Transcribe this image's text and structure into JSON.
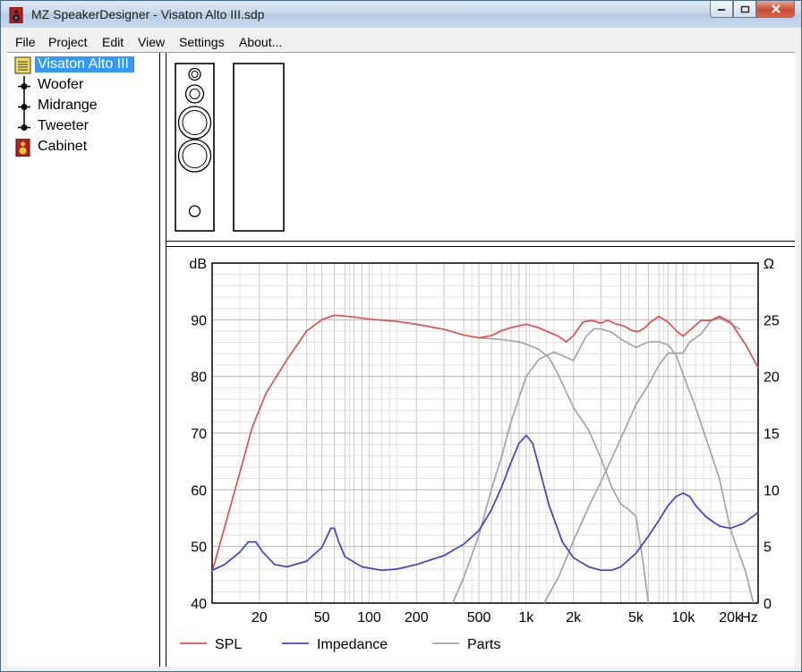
{
  "window": {
    "title": "MZ SpeakerDesigner - Visaton Alto III.sdp"
  },
  "menu": [
    "File",
    "Project",
    "Edit",
    "View",
    "Settings",
    "About..."
  ],
  "tree": {
    "project": "Visaton Alto III",
    "items": [
      "Woofer",
      "Midrange",
      "Tweeter",
      "Cabinet"
    ]
  },
  "colors": {
    "spl": "#e05050",
    "impedance": "#4040cc",
    "parts": "#a0a0a0",
    "selection": "#3399ff"
  },
  "chart_data": {
    "type": "line",
    "x_scale": "log",
    "xlim": [
      10,
      30000
    ],
    "x_ticks": [
      {
        "v": 20,
        "label": "20"
      },
      {
        "v": 50,
        "label": "50"
      },
      {
        "v": 100,
        "label": "100"
      },
      {
        "v": 200,
        "label": "200"
      },
      {
        "v": 500,
        "label": "500"
      },
      {
        "v": 1000,
        "label": "1k"
      },
      {
        "v": 2000,
        "label": "2k"
      },
      {
        "v": 5000,
        "label": "5k"
      },
      {
        "v": 10000,
        "label": "10k"
      },
      {
        "v": 20000,
        "label": "20k"
      }
    ],
    "x_unit": "Hz",
    "ylabel_left": "dB",
    "ylim_left": [
      40,
      100
    ],
    "y_ticks_left": [
      40,
      50,
      60,
      70,
      80,
      90
    ],
    "ylabel_right": "Ω",
    "ylim_right": [
      0,
      30
    ],
    "y_ticks_right": [
      0,
      5,
      10,
      15,
      20,
      25
    ],
    "grid": true,
    "legend_position": "bottom",
    "series": [
      {
        "name": "SPL",
        "axis": "left",
        "color": "#e05050",
        "points": [
          [
            10,
            45.5
          ],
          [
            15,
            63
          ],
          [
            18,
            71
          ],
          [
            22,
            77
          ],
          [
            30,
            83
          ],
          [
            40,
            88
          ],
          [
            50,
            90
          ],
          [
            60,
            90.8
          ],
          [
            80,
            90.5
          ],
          [
            100,
            90.1
          ],
          [
            150,
            89.7
          ],
          [
            200,
            89.2
          ],
          [
            300,
            88.3
          ],
          [
            400,
            87.3
          ],
          [
            500,
            86.8
          ],
          [
            600,
            87.2
          ],
          [
            700,
            88.1
          ],
          [
            800,
            88.6
          ],
          [
            1000,
            89.2
          ],
          [
            1200,
            88.6
          ],
          [
            1400,
            87.8
          ],
          [
            1600,
            87.1
          ],
          [
            1800,
            86.1
          ],
          [
            2000,
            87.2
          ],
          [
            2300,
            89.6
          ],
          [
            2600,
            89.9
          ],
          [
            3000,
            89.4
          ],
          [
            3300,
            89.9
          ],
          [
            3700,
            89.3
          ],
          [
            4200,
            88.9
          ],
          [
            4700,
            88.1
          ],
          [
            5200,
            87.9
          ],
          [
            5700,
            88.6
          ],
          [
            6200,
            89.6
          ],
          [
            7000,
            90.6
          ],
          [
            8000,
            89.6
          ],
          [
            9000,
            88.1
          ],
          [
            10000,
            87.1
          ],
          [
            11500,
            88.6
          ],
          [
            13000,
            89.9
          ],
          [
            15000,
            89.9
          ],
          [
            17000,
            90.6
          ],
          [
            20000,
            89.6
          ],
          [
            25000,
            85.6
          ],
          [
            30000,
            81.5
          ]
        ]
      },
      {
        "name": "Impedance",
        "axis": "right",
        "color": "#4040cc",
        "points": [
          [
            10,
            2.9
          ],
          [
            12,
            3.4
          ],
          [
            15,
            4.5
          ],
          [
            17,
            5.4
          ],
          [
            19,
            5.4
          ],
          [
            21,
            4.5
          ],
          [
            25,
            3.4
          ],
          [
            30,
            3.2
          ],
          [
            40,
            3.7
          ],
          [
            50,
            4.9
          ],
          [
            57,
            6.6
          ],
          [
            60,
            6.6
          ],
          [
            64,
            5.4
          ],
          [
            70,
            4.1
          ],
          [
            90,
            3.2
          ],
          [
            120,
            2.9
          ],
          [
            150,
            3.0
          ],
          [
            200,
            3.4
          ],
          [
            300,
            4.2
          ],
          [
            400,
            5.2
          ],
          [
            500,
            6.4
          ],
          [
            600,
            8.2
          ],
          [
            700,
            10.3
          ],
          [
            800,
            12.4
          ],
          [
            900,
            14.1
          ],
          [
            1000,
            14.8
          ],
          [
            1100,
            14.1
          ],
          [
            1200,
            12.1
          ],
          [
            1400,
            8.6
          ],
          [
            1700,
            5.4
          ],
          [
            2000,
            4.0
          ],
          [
            2500,
            3.2
          ],
          [
            3000,
            2.9
          ],
          [
            3500,
            2.9
          ],
          [
            4000,
            3.2
          ],
          [
            5000,
            4.4
          ],
          [
            6000,
            5.9
          ],
          [
            7000,
            7.3
          ],
          [
            8000,
            8.6
          ],
          [
            9000,
            9.4
          ],
          [
            10000,
            9.7
          ],
          [
            11000,
            9.4
          ],
          [
            12000,
            8.6
          ],
          [
            14000,
            7.6
          ],
          [
            17000,
            6.8
          ],
          [
            20000,
            6.6
          ],
          [
            24000,
            7.0
          ],
          [
            30000,
            8.0
          ]
        ]
      },
      {
        "name": "Parts",
        "axis": "left",
        "color": "#a0a0a0",
        "curves": [
          [
            [
              340,
              40
            ],
            [
              400,
              44.5
            ],
            [
              500,
              52
            ],
            [
              600,
              60
            ],
            [
              700,
              66
            ],
            [
              800,
              72
            ],
            [
              1000,
              80
            ],
            [
              1200,
              83
            ],
            [
              1500,
              84.3
            ],
            [
              2000,
              82.8
            ],
            [
              2400,
              87
            ],
            [
              2700,
              88.4
            ],
            [
              3000,
              88.4
            ],
            [
              3500,
              87.8
            ],
            [
              4000,
              86.6
            ],
            [
              5000,
              85.1
            ],
            [
              6000,
              86.1
            ],
            [
              7000,
              86.1
            ],
            [
              8000,
              85.6
            ],
            [
              9000,
              83.8
            ],
            [
              10000,
              80.3
            ],
            [
              12000,
              74.5
            ],
            [
              14000,
              69
            ],
            [
              17000,
              62
            ],
            [
              20000,
              53
            ],
            [
              25000,
              45.5
            ],
            [
              28000,
              40
            ]
          ],
          [
            [
              500,
              86.8
            ],
            [
              700,
              86.5
            ],
            [
              900,
              86.1
            ],
            [
              1000,
              85.7
            ],
            [
              1200,
              84.8
            ],
            [
              1400,
              83.3
            ],
            [
              1600,
              80.3
            ],
            [
              2000,
              74.5
            ],
            [
              2500,
              70.5
            ],
            [
              3000,
              65.5
            ],
            [
              3500,
              60.5
            ],
            [
              4000,
              57.5
            ],
            [
              4500,
              56.5
            ],
            [
              5000,
              55.3
            ],
            [
              5500,
              48
            ],
            [
              6000,
              40
            ]
          ],
          [
            [
              1300,
              40
            ],
            [
              1600,
              44.5
            ],
            [
              2000,
              51
            ],
            [
              2500,
              57
            ],
            [
              3000,
              61.5
            ],
            [
              3500,
              65.5
            ],
            [
              4000,
              69
            ],
            [
              5000,
              75
            ],
            [
              6000,
              78.5
            ],
            [
              7000,
              82
            ],
            [
              8000,
              84.1
            ],
            [
              9000,
              84.1
            ],
            [
              10000,
              84.1
            ],
            [
              11000,
              86.1
            ],
            [
              13000,
              87.5
            ],
            [
              15000,
              89.8
            ],
            [
              17000,
              90.3
            ],
            [
              20000,
              89.3
            ],
            [
              23000,
              88.3
            ]
          ]
        ]
      }
    ]
  }
}
